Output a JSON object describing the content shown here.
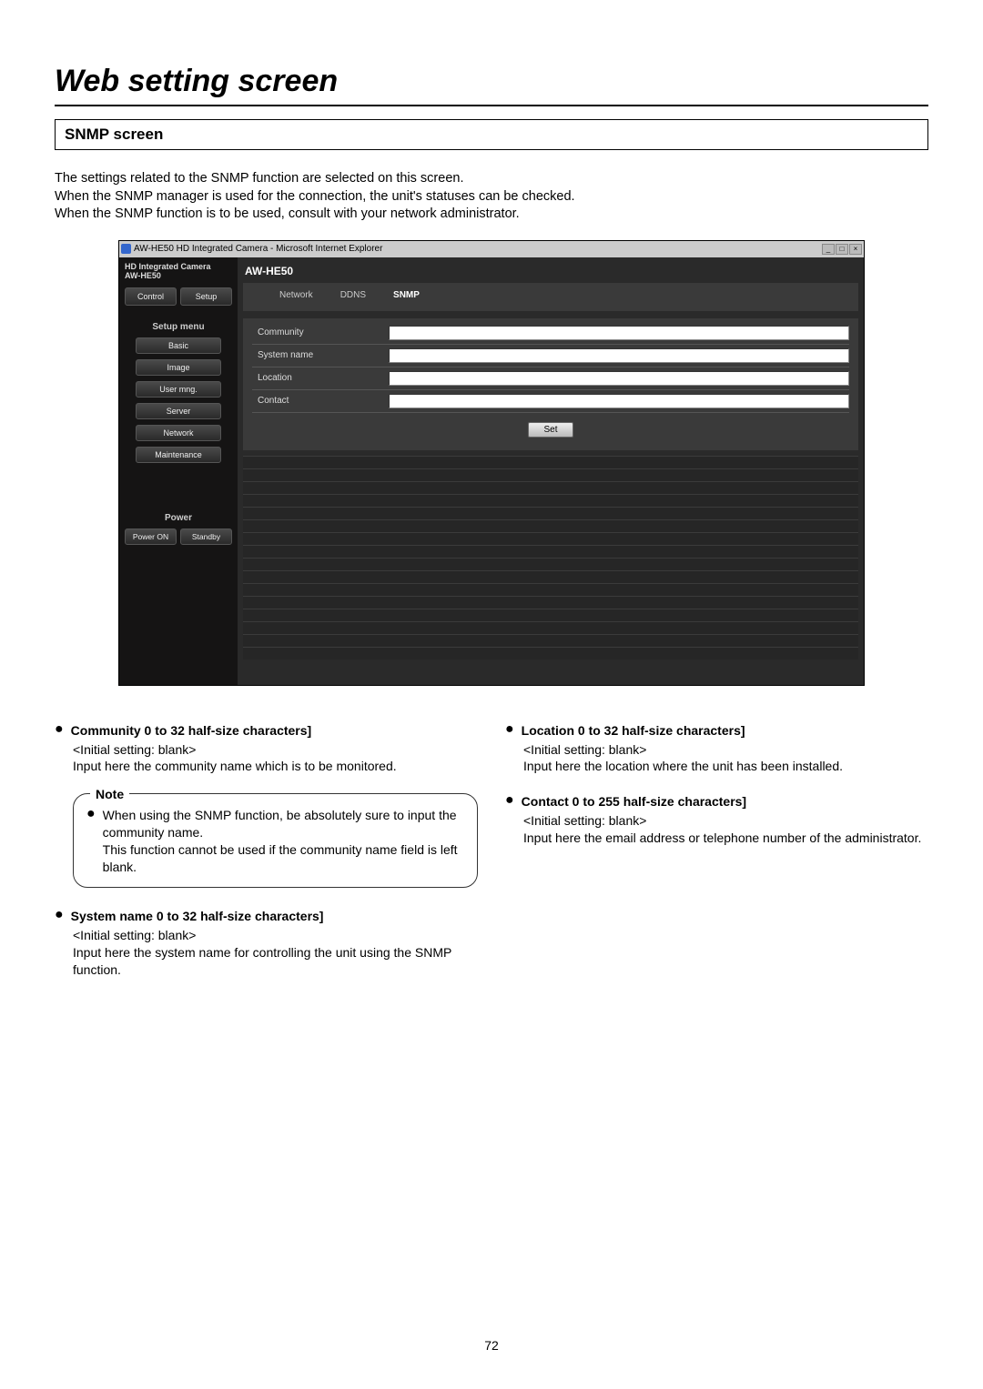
{
  "page": {
    "title": "Web setting screen",
    "section_title": "SNMP screen",
    "intro_lines": [
      "The settings related to the SNMP function are selected on this screen.",
      "When the SNMP manager is used for the connection, the unit's statuses can be checked.",
      "When the SNMP function is to be used, consult with your network administrator."
    ],
    "page_number": "72"
  },
  "screenshot": {
    "window_title": "AW-HE50 HD Integrated Camera - Microsoft Internet Explorer",
    "win_btn_min": "_",
    "win_btn_max": "□",
    "win_btn_close": "×",
    "sidebar_header": "HD Integrated Camera\nAW-HE50",
    "top_tabs": {
      "control": "Control",
      "setup": "Setup"
    },
    "setup_menu_label": "Setup menu",
    "menu_items": [
      "Basic",
      "Image",
      "User mng.",
      "Server",
      "Network",
      "Maintenance"
    ],
    "power_label": "Power",
    "power_buttons": {
      "on": "Power ON",
      "standby": "Standby"
    },
    "model_title": "AW-HE50",
    "tabs": {
      "network": "Network",
      "ddns": "DDNS",
      "snmp": "SNMP"
    },
    "form": {
      "community": {
        "label": "Community",
        "value": ""
      },
      "system_name": {
        "label": "System name",
        "value": ""
      },
      "location": {
        "label": "Location",
        "value": ""
      },
      "contact": {
        "label": "Contact",
        "value": ""
      },
      "set_button": "Set"
    }
  },
  "desc": {
    "community": {
      "head": "Community 0 to 32 half-size characters]",
      "initial": "<Initial setting: blank>",
      "body": "Input here the community name which is to be monitored."
    },
    "note_title": "Note",
    "note_body": "When using the SNMP function, be absolutely sure to input the community name.\nThis function cannot be used if the community name field is left blank.",
    "system_name": {
      "head": "System name 0 to 32 half-size characters]",
      "initial": "<Initial setting: blank>",
      "body": "Input here the system name for controlling the unit using the SNMP function."
    },
    "location": {
      "head": "Location 0 to 32 half-size characters]",
      "initial": "<Initial setting: blank>",
      "body": "Input here the location where the unit has been installed."
    },
    "contact": {
      "head": "Contact 0 to 255 half-size characters]",
      "initial": "<Initial setting: blank>",
      "body": "Input here the email address or telephone number of the administrator."
    }
  }
}
